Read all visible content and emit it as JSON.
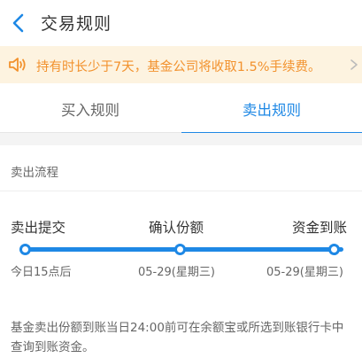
{
  "header": {
    "title": "交易规则"
  },
  "notice": {
    "text": "持有时长少于7天，基金公司将收取1.5%手续费。"
  },
  "tabs": [
    {
      "label": "买入规则",
      "active": false
    },
    {
      "label": "卖出规则",
      "active": true
    }
  ],
  "section": {
    "label": "卖出流程"
  },
  "steps": [
    {
      "title": "卖出提交",
      "date": "今日15点后"
    },
    {
      "title": "确认份额",
      "date": "05-29(星期三)"
    },
    {
      "title": "资金到账",
      "date": "05-29(星期三)"
    }
  ],
  "description": "基金卖出份额到账当日24:00前可在余额宝或所选到账银行卡中查询到账资金。",
  "colors": {
    "accent": "#1e88e5",
    "notice_text": "#f2922e",
    "notice_bg": "#fdf3e0"
  }
}
